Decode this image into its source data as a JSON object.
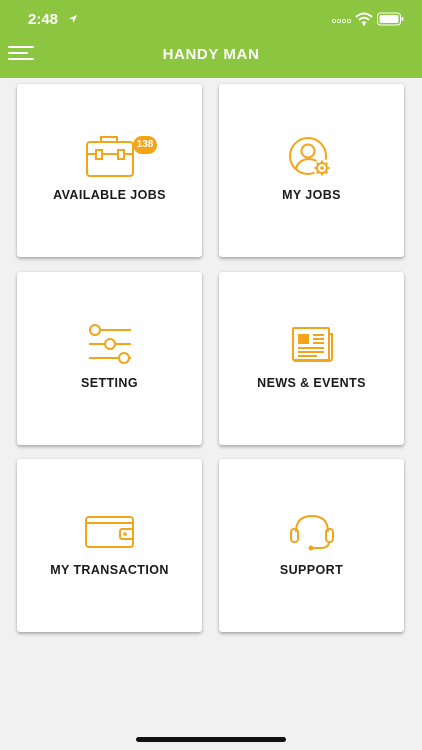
{
  "status_bar": {
    "time": "2:48"
  },
  "header": {
    "title": "HANDY MAN"
  },
  "tiles": [
    {
      "label": "AVAILABLE JOBS",
      "icon": "briefcase-icon",
      "badge": "138"
    },
    {
      "label": "MY JOBS",
      "icon": "user-gear-icon"
    },
    {
      "label": "SETTING",
      "icon": "sliders-icon"
    },
    {
      "label": "NEWS & EVENTS",
      "icon": "newspaper-icon"
    },
    {
      "label": "MY TRANSACTION",
      "icon": "wallet-icon"
    },
    {
      "label": "SUPPORT",
      "icon": "headset-icon"
    }
  ],
  "colors": {
    "header_bg": "#8cc53f",
    "accent": "#f3a51a",
    "background": "#f1f1f1"
  }
}
